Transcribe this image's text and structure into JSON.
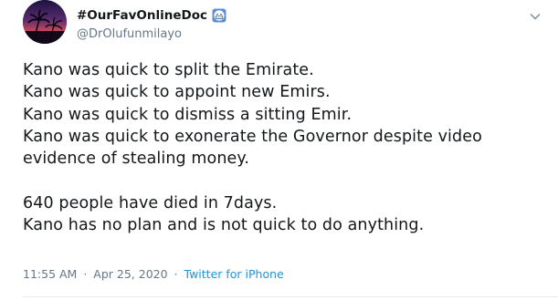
{
  "tweet": {
    "display_name": "#OurFavOnlineDoc",
    "handle": "@DrOlufunmilayo",
    "body_lines": [
      "Kano was quick to split the Emirate.",
      "Kano was quick to appoint new Emirs.",
      "Kano was quick to dismiss a sitting Emir.",
      "Kano was quick to exonerate the Governor despite video",
      "evidence of stealing money.",
      "640 people have died in 7days.",
      "Kano has no plan and is not quick to do anything."
    ],
    "time": "11:55 AM",
    "separator": "·",
    "date": "Apr 25, 2020",
    "source": "Twitter for iPhone"
  },
  "icons": {
    "avatar": "avatar-sunset-palm-image",
    "badge": "medical-mask-emoji-icon",
    "caret": "chevron-down-icon"
  },
  "colors": {
    "text": "#14171a",
    "secondary": "#657786",
    "link": "#1b95e0",
    "divider": "#e6ecf0"
  }
}
